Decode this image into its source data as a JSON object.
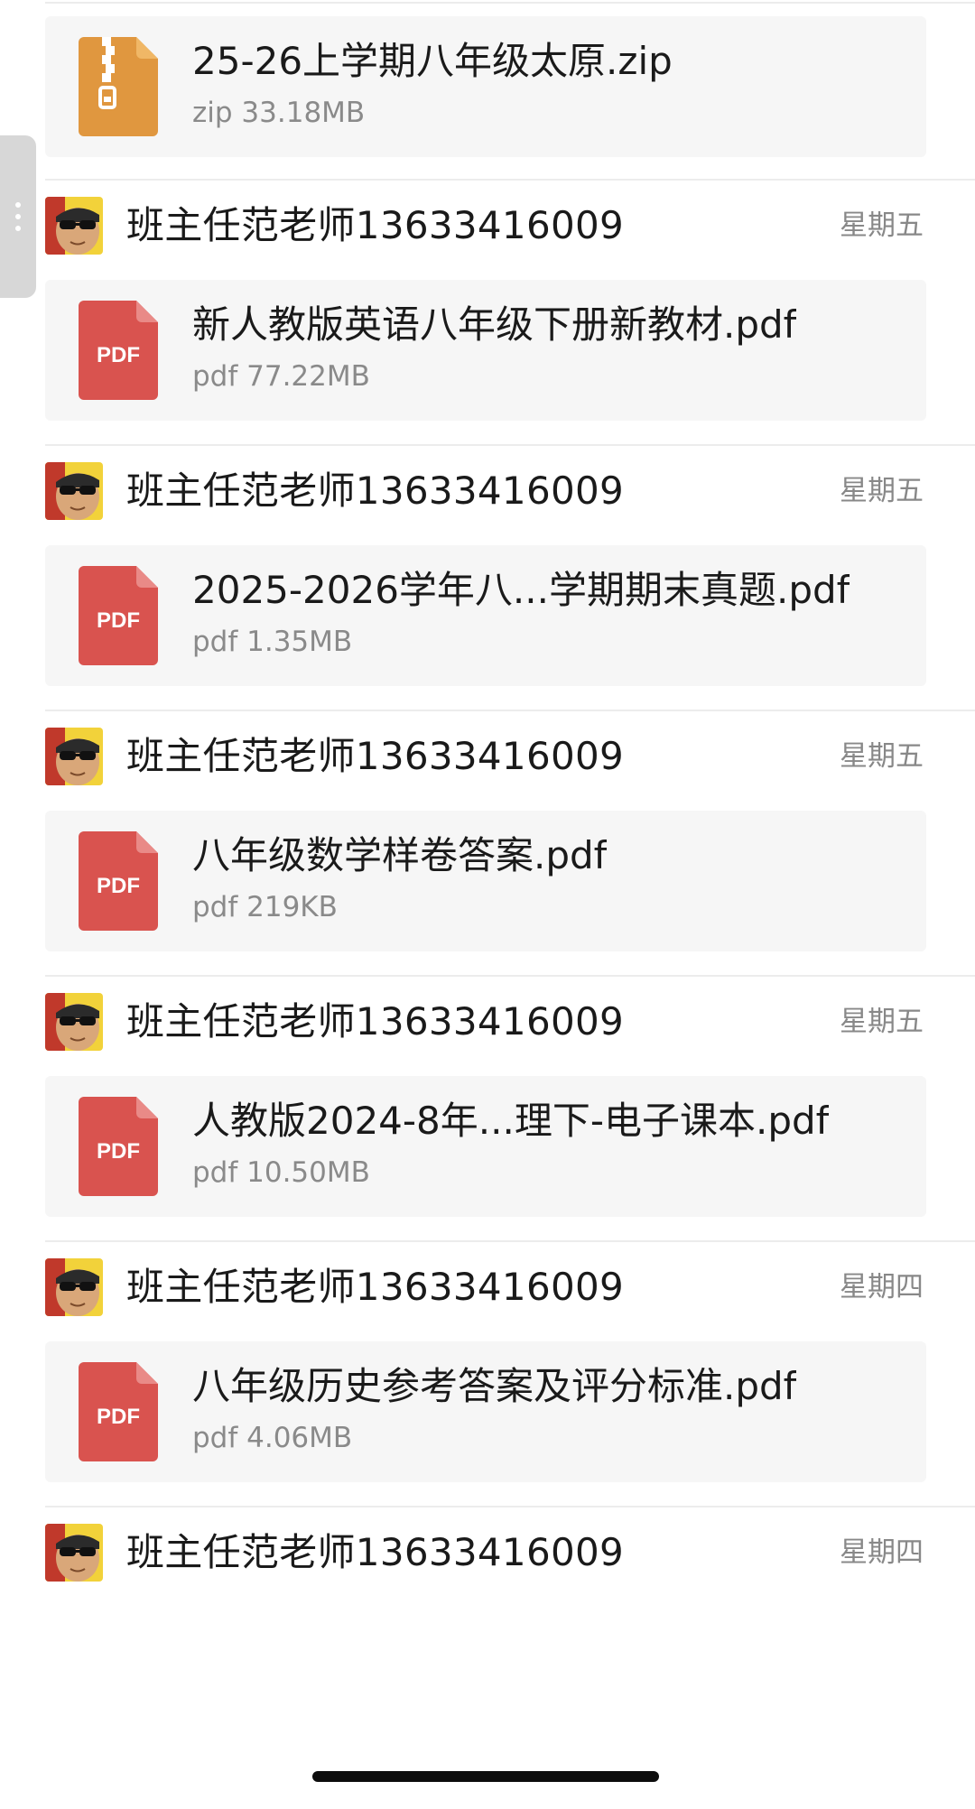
{
  "partial_top_card": {
    "file_type": "zip",
    "icon": "zip-archive-icon",
    "name": "25-26上学期八年级太原.zip",
    "meta": "zip 33.18MB"
  },
  "messages": [
    {
      "sender": "班主任范老师13633416009",
      "day": "星期五",
      "avatar": "avatar-sunglasses-icon",
      "file": {
        "file_type": "pdf",
        "icon_label": "PDF",
        "name": "新人教版英语八年级下册新教材.pdf",
        "meta": "pdf 77.22MB"
      }
    },
    {
      "sender": "班主任范老师13633416009",
      "day": "星期五",
      "avatar": "avatar-sunglasses-icon",
      "file": {
        "file_type": "pdf",
        "icon_label": "PDF",
        "name": "2025-2026学年八...学期期末真题.pdf",
        "meta": "pdf 1.35MB"
      }
    },
    {
      "sender": "班主任范老师13633416009",
      "day": "星期五",
      "avatar": "avatar-sunglasses-icon",
      "file": {
        "file_type": "pdf",
        "icon_label": "PDF",
        "name": "八年级数学样卷答案.pdf",
        "meta": "pdf 219KB"
      }
    },
    {
      "sender": "班主任范老师13633416009",
      "day": "星期五",
      "avatar": "avatar-sunglasses-icon",
      "file": {
        "file_type": "pdf",
        "icon_label": "PDF",
        "name": "人教版2024-8年...理下-电子课本.pdf",
        "meta": "pdf 10.50MB"
      }
    },
    {
      "sender": "班主任范老师13633416009",
      "day": "星期四",
      "avatar": "avatar-sunglasses-icon",
      "file": {
        "file_type": "pdf",
        "icon_label": "PDF",
        "name": "八年级历史参考答案及评分标准.pdf",
        "meta": "pdf 4.06MB"
      }
    },
    {
      "sender": "班主任范老师13633416009",
      "day": "星期四",
      "avatar": "avatar-sunglasses-icon"
    }
  ],
  "colors": {
    "pdf_red": "#d9534f",
    "zip_orange": "#e0973f",
    "card_bg": "#f6f6f6",
    "secondary_text": "#8a8a8a"
  }
}
